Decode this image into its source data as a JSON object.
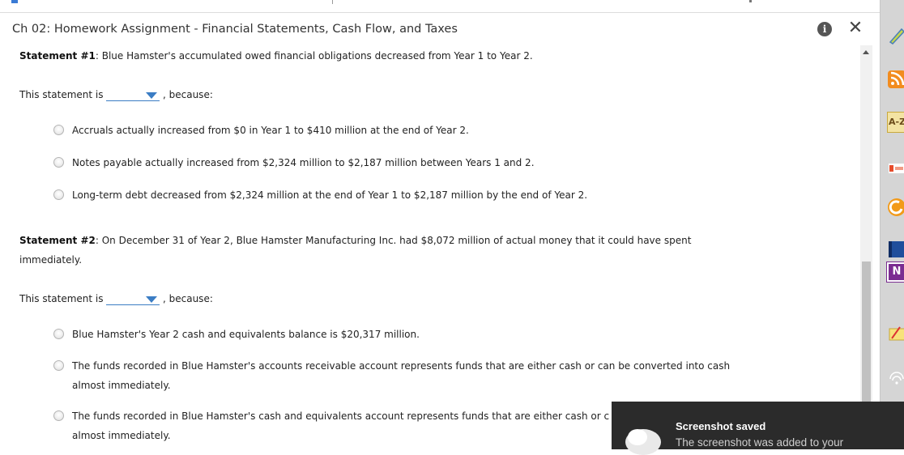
{
  "window": {
    "title": "Ch 02: Homework Assignment - Financial Statements, Cash Flow, and Taxes",
    "info_icon": "i",
    "close_icon": "✕"
  },
  "statements": [
    {
      "label": "Statement #1",
      "text": ": Blue Hamster's accumulated owed financial obligations decreased from Year 1 to Year 2.",
      "prompt_prefix": "This statement is",
      "prompt_suffix": ", because:",
      "options": [
        "Accruals actually increased from $0 in Year 1 to $410 million at the end of Year 2.",
        "Notes payable actually increased from $2,324 million to $2,187 million between Years 1 and 2.",
        "Long-term debt decreased from $2,324 million at the end of Year 1 to $2,187 million by the end of Year 2."
      ]
    },
    {
      "label": "Statement #2",
      "text": ": On December 31 of Year 2, Blue Hamster Manufacturing Inc. had $8,072 million of actual money that it could have spent immediately.",
      "prompt_prefix": "This statement is",
      "prompt_suffix": ", because:",
      "options": [
        "Blue Hamster's Year 2 cash and equivalents balance is $20,317 million.",
        "The funds recorded in Blue Hamster's accounts receivable account represents funds that are either cash or can be converted into cash almost immediately.",
        "The funds recorded in Blue Hamster's cash and equivalents account represents funds that are either cash or c almost immediately."
      ]
    }
  ],
  "opt_c_line1": "The funds recorded in Blue Hamster's cash and equivalents account represents funds that are either cash or c",
  "opt_c_line2": "almost immediately.",
  "opt_b_line1": "The funds recorded in Blue Hamster's accounts receivable account represents funds that are either cash or can be converted into cash",
  "opt_b_line2": "almost immediately.",
  "stmt2_line1": ": On December 31 of Year 2, Blue Hamster Manufacturing Inc. had $8,072 million of actual money that it could have spent",
  "stmt2_line2": "immediately.",
  "toast": {
    "title": "Screenshot saved",
    "body": "The screenshot was added to your"
  },
  "taskbar": {
    "az_label": "A-Z",
    "note_label": "N"
  },
  "colors": {
    "accent": "#3b7dc4",
    "toast_bg": "#2b2b2b"
  }
}
